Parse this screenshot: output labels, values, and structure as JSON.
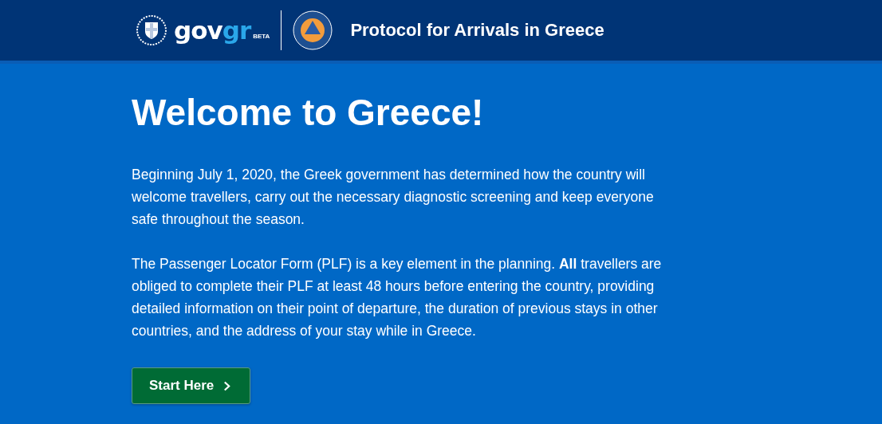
{
  "header": {
    "wordmark": [
      "gov",
      "gr"
    ],
    "badge": "BETA",
    "title": "Protocol for Arrivals in Greece"
  },
  "main": {
    "heading": "Welcome to Greece!",
    "paragraphs": [
      "Beginning July 1, 2020, the Greek government has determined how the country will welcome travellers, carry out the necessary diagnostic screening and keep everyone safe throughout the season.",
      "The Passenger Locator Form (PLF) is a key element in the planning. **All** travellers are obliged to complete their PLF at least 48 hours before entering the country, providing detailed information on their point of departure, the duration of previous stays in other countries, and the address of your stay while in Greece."
    ],
    "button": {
      "label": "Start Here"
    }
  }
}
